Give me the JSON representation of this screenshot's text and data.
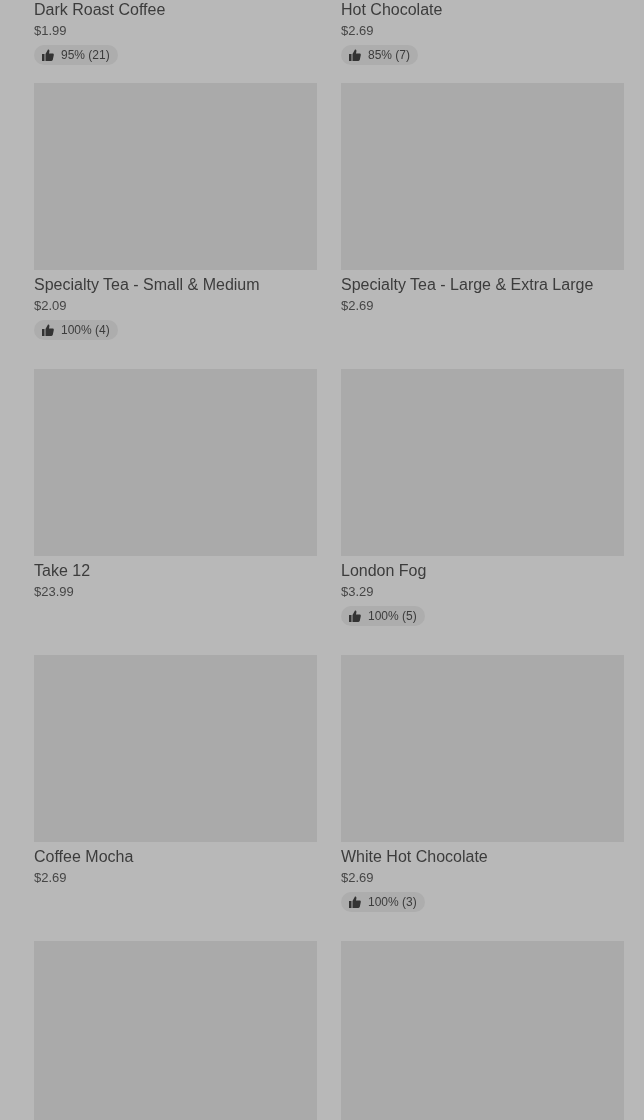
{
  "products": [
    {
      "kind": "partial",
      "name": "Dark Roast Coffee",
      "price": "$1.99",
      "rating": "95% (21)"
    },
    {
      "kind": "partial",
      "name": "Hot Chocolate",
      "price": "$2.69",
      "rating": "85% (7)"
    },
    {
      "kind": "card",
      "name": "Specialty Tea - Small & Medium",
      "price": "$2.09",
      "rating": "100% (4)"
    },
    {
      "kind": "card",
      "name": "Specialty Tea - Large & Extra Large",
      "price": "$2.69"
    },
    {
      "kind": "card",
      "name": "Take 12",
      "price": "$23.99"
    },
    {
      "kind": "card",
      "name": "London Fog",
      "price": "$3.29",
      "rating": "100% (5)"
    },
    {
      "kind": "card",
      "name": "Coffee Mocha",
      "price": "$2.69"
    },
    {
      "kind": "card",
      "name": "White Hot Chocolate",
      "price": "$2.69",
      "rating": "100% (3)"
    },
    {
      "kind": "card"
    },
    {
      "kind": "card"
    }
  ]
}
